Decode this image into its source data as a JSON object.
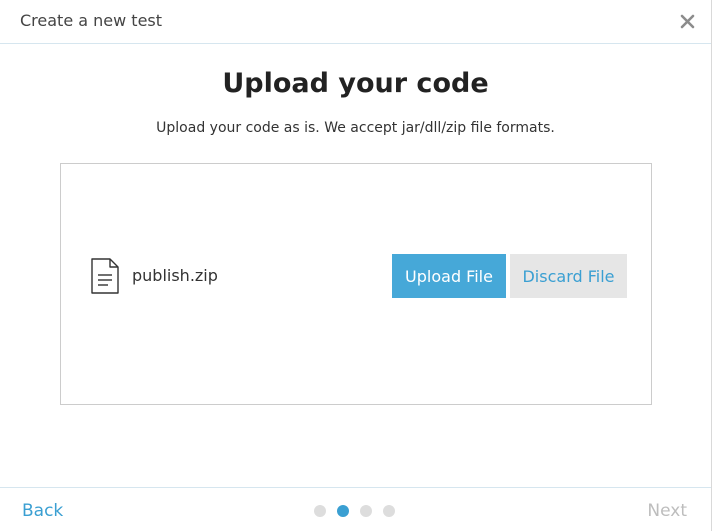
{
  "header": {
    "title": "Create a new test",
    "close_icon": "close-icon"
  },
  "main": {
    "title": "Upload your code",
    "subtitle": "Upload your code as is. We accept jar/dll/zip file formats."
  },
  "upload": {
    "file_icon": "file-document-icon",
    "file_name": "publish.zip",
    "upload_label": "Upload File",
    "discard_label": "Discard File"
  },
  "footer": {
    "back_label": "Back",
    "next_label": "Next",
    "steps_total": 4,
    "active_step": 2
  },
  "colors": {
    "accent": "#46a8d8",
    "link": "#3a9fd2",
    "disabled": "#bdbdbd",
    "discard_bg": "#e6e6e6"
  }
}
